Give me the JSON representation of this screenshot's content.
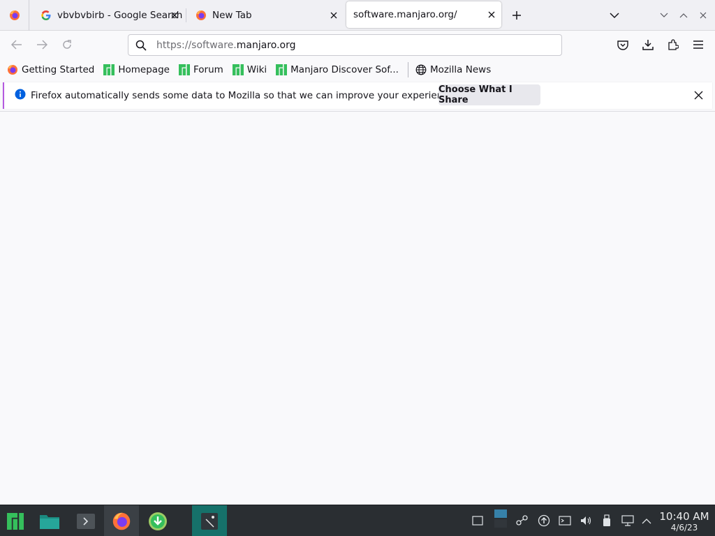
{
  "tabs": [
    {
      "title": "vbvbvbirb - Google Search",
      "favicon": "google-icon"
    },
    {
      "title": "New Tab",
      "favicon": "firefox-icon"
    },
    {
      "title": "software.manjaro.org/",
      "favicon": "none",
      "selected": true
    }
  ],
  "navbar": {
    "url_prefix": "https://software.",
    "url_domain": "manjaro.org"
  },
  "bookmarks": [
    {
      "label": "Getting Started",
      "icon": "firefox-icon"
    },
    {
      "label": "Homepage",
      "icon": "manjaro-icon"
    },
    {
      "label": "Forum",
      "icon": "manjaro-icon"
    },
    {
      "label": "Wiki",
      "icon": "manjaro-icon"
    },
    {
      "label": "Manjaro Discover Sof...",
      "icon": "manjaro-icon"
    },
    {
      "label": "Mozilla News",
      "icon": "globe-icon"
    }
  ],
  "notification": {
    "message": "Firefox automatically sends some data to Mozilla so that we can improve your experience.",
    "button": "Choose What I Share"
  },
  "taskbar": {
    "time": "10:40 AM",
    "date": "4/6/23"
  },
  "colors": {
    "manjaro_green": "#35bf5c",
    "info_blue": "#0060df",
    "notification_accent": "#b45ae0",
    "taskbar_bg": "#2a2e32",
    "taskbar_selected": "#16716a"
  }
}
